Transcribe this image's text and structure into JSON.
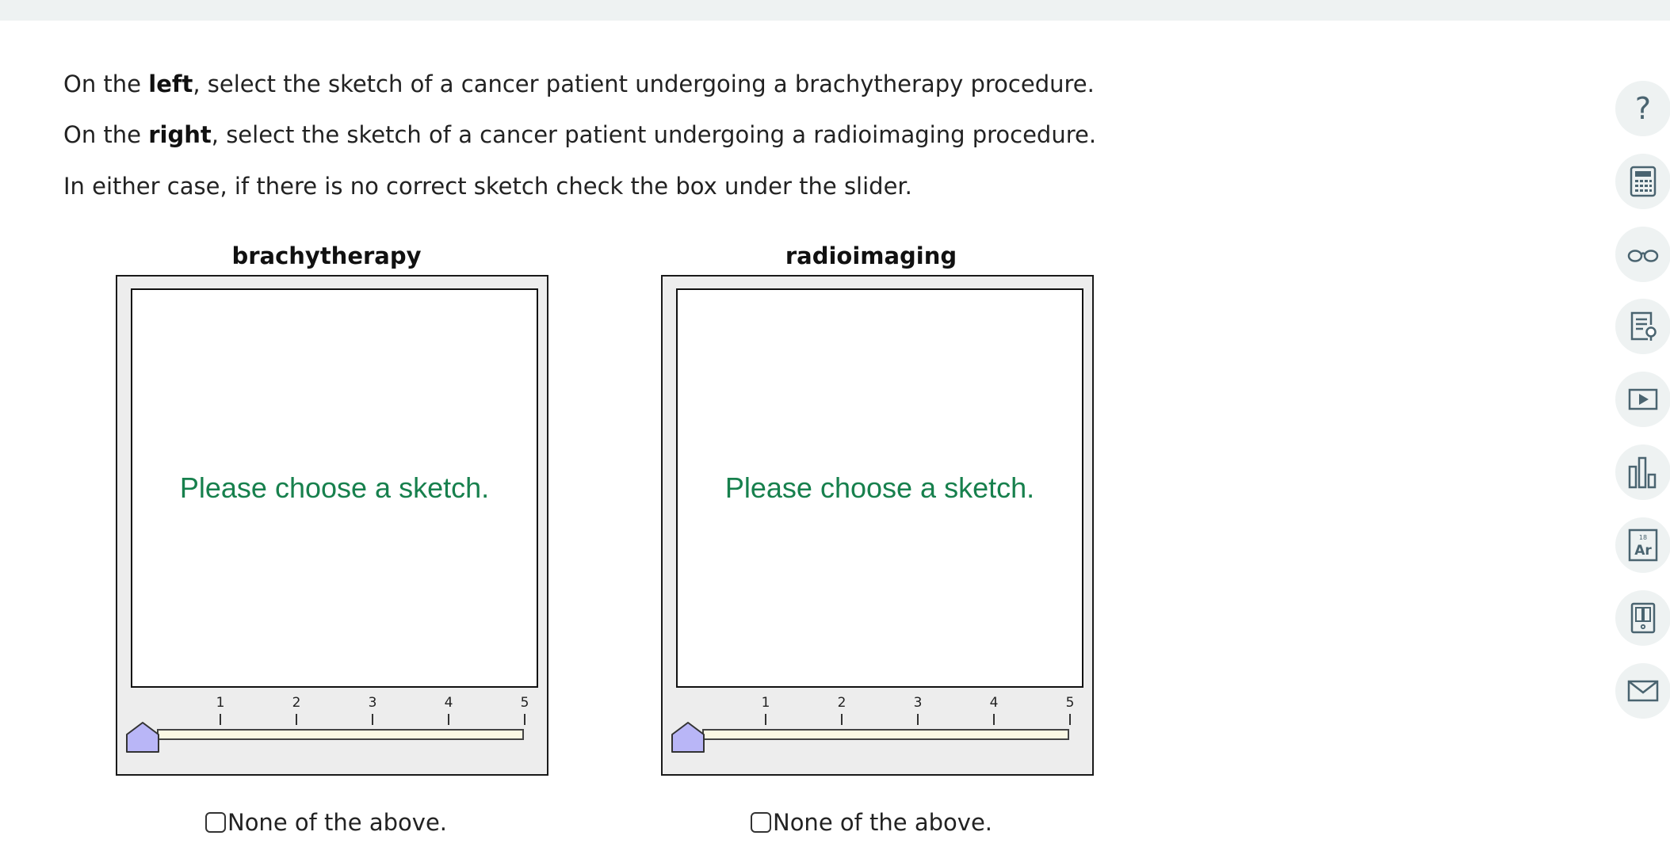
{
  "instructions": {
    "line1": {
      "pre": "On the ",
      "bold": "left",
      "post": ", select the sketch of a cancer patient undergoing a brachytherapy procedure."
    },
    "line2": {
      "pre": "On the ",
      "bold": "right",
      "post": ", select the sketch of a cancer patient undergoing a radioimaging procedure."
    },
    "line3": "In either case, if there is no correct sketch check the box under the slider."
  },
  "panels": [
    {
      "title": "brachytherapy",
      "prompt": "Please choose a sketch.",
      "slider": {
        "ticks": [
          "1",
          "2",
          "3",
          "4",
          "5"
        ],
        "value": 0
      },
      "none_label": "None of the above.",
      "none_checked": false
    },
    {
      "title": "radioimaging",
      "prompt": "Please choose a sketch.",
      "slider": {
        "ticks": [
          "1",
          "2",
          "3",
          "4",
          "5"
        ],
        "value": 0
      },
      "none_label": "None of the above.",
      "none_checked": false
    }
  ],
  "toolbar": {
    "help_glyph": "?",
    "icons": [
      "help-icon",
      "calculator-icon",
      "glasses-icon",
      "notes-icon",
      "video-icon",
      "chart-icon",
      "periodic-table-icon",
      "ebook-icon",
      "mail-icon"
    ],
    "periodic_element": {
      "number": "18",
      "symbol": "Ar"
    }
  },
  "colors": {
    "prompt_green": "#17804d",
    "thumb_fill": "#b9b6f7",
    "track_fill": "#fbf8e4",
    "panel_bg": "#ededed",
    "tool_bg": "#eef2f2",
    "icon_stroke": "#4a6470"
  }
}
